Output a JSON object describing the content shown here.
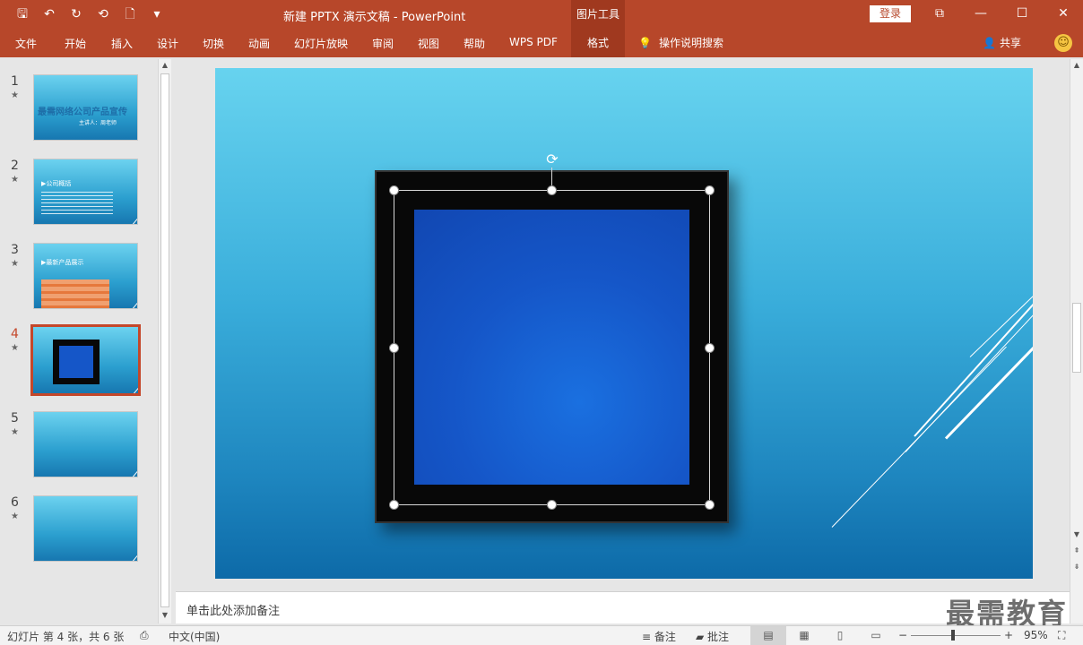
{
  "titlebar": {
    "title": "新建 PPTX 演示文稿  -  PowerPoint",
    "tool_tab": "图片工具",
    "login": "登录",
    "qat_icons": [
      "save-icon",
      "undo-icon",
      "redo-icon",
      "present-from-start-icon",
      "new-file-icon",
      "customize-icon"
    ],
    "qat_glyphs": [
      "🖫",
      "↶",
      "↻",
      "⟲",
      "🗋",
      "▾"
    ],
    "window_glyphs": [
      "⧉",
      "—",
      "☐",
      "✕"
    ]
  },
  "ribbon": {
    "tabs": [
      "文件",
      "开始",
      "插入",
      "设计",
      "切换",
      "动画",
      "幻灯片放映",
      "审阅",
      "视图",
      "帮助",
      "WPS PDF",
      "格式"
    ],
    "active_tab": "格式",
    "help_glyph": "💡",
    "help_text": "操作说明搜索",
    "share_glyph": "👤",
    "share_text": "共享",
    "smiley_glyph": "☺"
  },
  "thumbnails": {
    "active": 4,
    "star_glyph": "★",
    "items": [
      {
        "num": "1",
        "title": "最需网络公司产品宣传",
        "subtitle": "主讲人：周老师"
      },
      {
        "num": "2",
        "title": "▶公司概括"
      },
      {
        "num": "3",
        "title": "▶最新产品展示"
      },
      {
        "num": "4"
      },
      {
        "num": "5"
      },
      {
        "num": "6"
      }
    ]
  },
  "slide": {
    "rotate_glyph": "⟳"
  },
  "notes": {
    "placeholder": "单击此处添加备注"
  },
  "watermark": "最需教育",
  "status": {
    "slide_info": "幻灯片 第 4 张，共 6 张",
    "language": "中文(中国)",
    "notes_label": "备注",
    "comments_label": "批注",
    "zoom": "95%",
    "zoom_minus": "−",
    "zoom_plus": "+"
  }
}
